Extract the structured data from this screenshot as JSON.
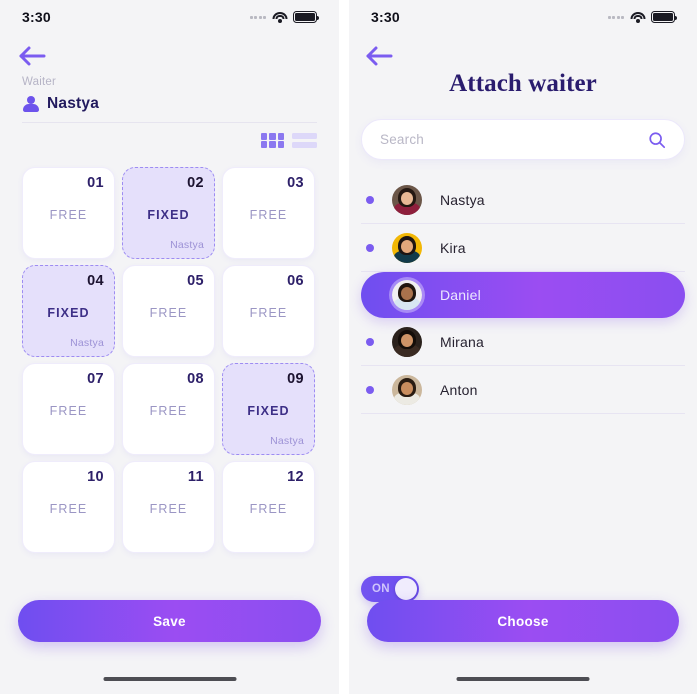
{
  "status_bar": {
    "time": "3:30",
    "signal_icon": "signal-dots-icon",
    "wifi_icon": "wifi-icon",
    "battery_icon": "battery-icon"
  },
  "colors": {
    "accent": "#6f4ef0",
    "accent_alt": "#9b4df2",
    "page_bg": "#f4f4f6",
    "card_bg": "#ffffff",
    "fixed_card_bg": "#e5e0fb",
    "fixed_card_border": "#9d8cf2",
    "title_navy": "#2a1c6e",
    "muted": "#b6b4c6"
  },
  "left_screen": {
    "back_icon": "back-arrow-icon",
    "waiter_label": "Waiter",
    "waiter_name": "Nastya",
    "waiter_icon": "person-icon",
    "view_switcher": {
      "grid_icon": "grid-view-icon",
      "list_icon": "list-view-icon",
      "active": "grid"
    },
    "tables": [
      {
        "number": "01",
        "state": "FREE",
        "owner": ""
      },
      {
        "number": "02",
        "state": "FIXED",
        "owner": "Nastya"
      },
      {
        "number": "03",
        "state": "FREE",
        "owner": ""
      },
      {
        "number": "04",
        "state": "FIXED",
        "owner": "Nastya"
      },
      {
        "number": "05",
        "state": "FREE",
        "owner": ""
      },
      {
        "number": "06",
        "state": "FREE",
        "owner": ""
      },
      {
        "number": "07",
        "state": "FREE",
        "owner": ""
      },
      {
        "number": "08",
        "state": "FREE",
        "owner": ""
      },
      {
        "number": "09",
        "state": "FIXED",
        "owner": "Nastya"
      },
      {
        "number": "10",
        "state": "FREE",
        "owner": ""
      },
      {
        "number": "11",
        "state": "FREE",
        "owner": ""
      },
      {
        "number": "12",
        "state": "FREE",
        "owner": ""
      }
    ],
    "save_button": "Save"
  },
  "right_screen": {
    "back_icon": "back-arrow-icon",
    "title": "Attach waiter",
    "search": {
      "value": "",
      "placeholder": "Search",
      "icon": "search-icon"
    },
    "waiters": [
      {
        "name": "Nastya",
        "selected": false
      },
      {
        "name": "Kira",
        "selected": false
      },
      {
        "name": "Daniel",
        "selected": true
      },
      {
        "name": "Mirana",
        "selected": false
      },
      {
        "name": "Anton",
        "selected": false
      }
    ],
    "toggle": {
      "label": "ON",
      "state": "on"
    },
    "choose_button": "Choose"
  }
}
